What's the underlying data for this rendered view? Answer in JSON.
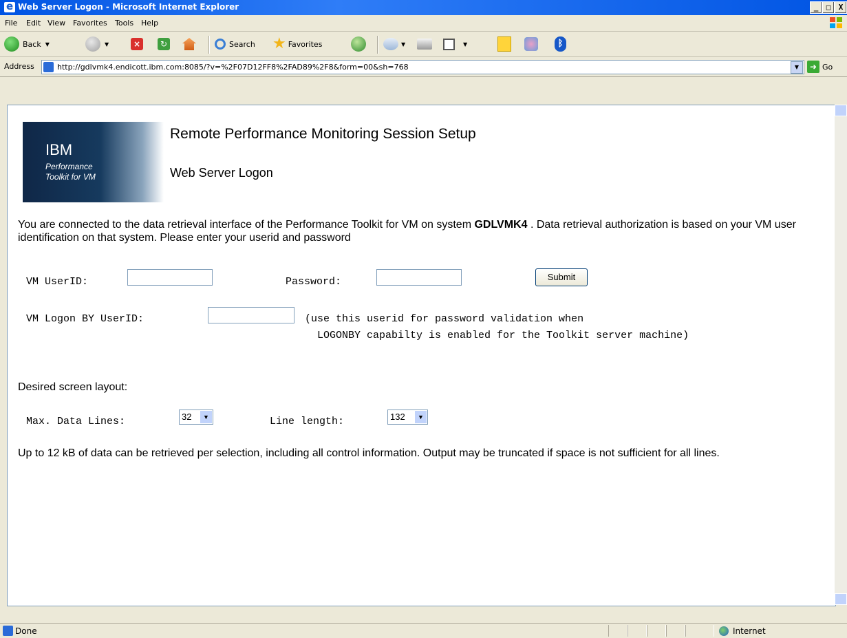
{
  "window": {
    "title": "Web Server Logon - Microsoft Internet Explorer",
    "controls": [
      "_",
      "□",
      "X"
    ]
  },
  "menu": [
    "File",
    "Edit",
    "View",
    "Favorites",
    "Tools",
    "Help"
  ],
  "toolbar": {
    "back_label": "Back",
    "search_label": "Search",
    "favorites_label": "Favorites"
  },
  "address": {
    "label": "Address",
    "url": "http://gdlvmk4.endicott.ibm.com:8085/?v=%2F07D12FF8%2FAD89%2F8&form=00&sh=768",
    "go_label": "Go"
  },
  "logo": {
    "brand": "IBM",
    "product_line1": "Performance",
    "product_line2": "Toolkit for VM"
  },
  "page": {
    "heading": "Remote Performance Monitoring Session Setup",
    "subheading": "Web Server Logon",
    "intro_before": "You are connected to the data retrieval interface of the Performance Toolkit for VM on system ",
    "system_name": "GDLVMK4",
    "intro_after": " . Data retrieval authorization is based on your VM user identification on that system. Please enter your userid and password",
    "userid_label": "VM UserID:",
    "userid_value": "",
    "password_label": "Password:",
    "password_value": "",
    "submit_label": "Submit",
    "logonby_label": "VM Logon BY UserID:",
    "logonby_value": "",
    "logonby_note_line1": "(use this userid for password validation when",
    "logonby_note_line2": "LOGONBY capabilty is enabled for the Toolkit server machine)",
    "layout_heading": "Desired screen layout:",
    "max_lines_label": "Max. Data Lines:",
    "max_lines_value": "32",
    "line_length_label": "Line length:",
    "line_length_value": "132",
    "footer_note": "Up to 12 kB of data can be retrieved per selection, including all control information. Output may be truncated if space is not sufficient for all lines."
  },
  "status": {
    "text": "Done",
    "zone": "Internet"
  }
}
